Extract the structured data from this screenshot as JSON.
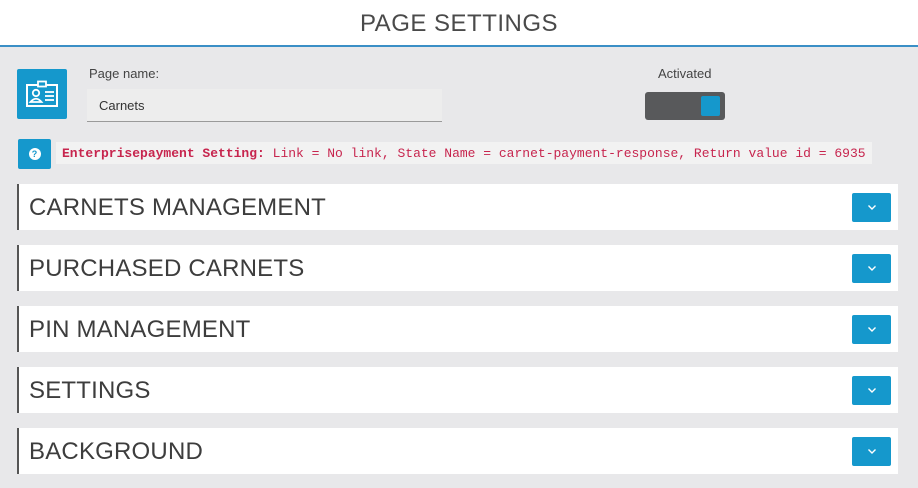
{
  "header": {
    "title": "PAGE SETTINGS"
  },
  "page_icon": {
    "icon": "id-card-icon"
  },
  "page_name": {
    "label": "Page name:",
    "value": "Carnets",
    "placeholder": ""
  },
  "activated": {
    "label": "Activated",
    "state": "on"
  },
  "info": {
    "key": "Enterprisepayment Setting:",
    "text": " Link = No link, State Name = carnet-payment-response, Return value id = 6935"
  },
  "sections": [
    {
      "title": "CARNETS MANAGEMENT"
    },
    {
      "title": "PURCHASED CARNETS"
    },
    {
      "title": "PIN MANAGEMENT"
    },
    {
      "title": "SETTINGS"
    },
    {
      "title": "BACKGROUND"
    }
  ],
  "colors": {
    "accent": "#1598cc",
    "header_border": "#3a8fc6",
    "info_text": "#c7254e",
    "toggle_track": "#58595b"
  }
}
